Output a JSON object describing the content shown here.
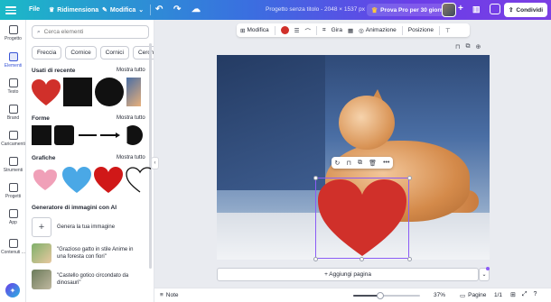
{
  "topbar": {
    "file": "File",
    "resize": "Ridimensiona",
    "edit": "Modifica",
    "doc_title": "Progetto senza titolo - 2048 × 1537 px",
    "pro_button": "Prova Pro per 30 giorni",
    "share": "Condividi"
  },
  "rail": {
    "items": [
      {
        "label": "Progetto"
      },
      {
        "label": "Elementi"
      },
      {
        "label": "Testo"
      },
      {
        "label": "Brand"
      },
      {
        "label": "Caricamenti"
      },
      {
        "label": "Strumenti"
      },
      {
        "label": "Progetti"
      },
      {
        "label": "App"
      },
      {
        "label": "Contenuti ..."
      }
    ]
  },
  "panel": {
    "search_placeholder": "Cerca elementi",
    "chips": [
      "Freccia",
      "Cornice",
      "Cornici",
      "Cerchio"
    ],
    "sections": {
      "recent": {
        "title": "Usati di recente",
        "more": "Mostra tutto"
      },
      "shapes": {
        "title": "Forme",
        "more": "Mostra tutto"
      },
      "graphics": {
        "title": "Grafiche",
        "more": "Mostra tutto"
      },
      "ai": {
        "title": "Generatore di immagini con AI"
      }
    },
    "ai_items": [
      {
        "text": "Genera la tua immagine"
      },
      {
        "text": "\"Grazioso gatto in stile Anime in una foresta con fiori\""
      },
      {
        "text": "\"Castello gotico circondato da dinosauri\""
      }
    ]
  },
  "context_toolbar": {
    "edit": "Modifica",
    "rotate": "Gira",
    "animation": "Animazione",
    "position": "Posizione",
    "color": "#d0302a"
  },
  "canvas": {
    "add_page": "+ Aggiungi pagina",
    "heart_color": "#d0302a"
  },
  "bottombar": {
    "notes": "Note",
    "zoom": "37%",
    "zoom_level": 0.37,
    "pages": "Pagine",
    "page_count": "1/1"
  }
}
